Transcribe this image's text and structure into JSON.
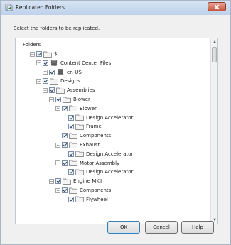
{
  "window": {
    "title": "Replicated Folders",
    "instruction": "Select the folders to be replicated."
  },
  "panel": {
    "label": "Folders"
  },
  "tree": {
    "nodes": [
      {
        "label": "$",
        "depth": 0,
        "expander": "−",
        "checked": true,
        "icon": "folder"
      },
      {
        "label": "Content Center Files",
        "depth": 1,
        "expander": "−",
        "checked": true,
        "icon": "database"
      },
      {
        "label": "en-US",
        "depth": 2,
        "expander": "+",
        "checked": true,
        "icon": "database"
      },
      {
        "label": "Designs",
        "depth": 1,
        "expander": "−",
        "checked": true,
        "icon": "folder"
      },
      {
        "label": "Assemblies",
        "depth": 2,
        "expander": "−",
        "checked": true,
        "icon": "folder"
      },
      {
        "label": "Blower",
        "depth": 3,
        "expander": "−",
        "checked": true,
        "icon": "folder"
      },
      {
        "label": "Blower",
        "depth": 4,
        "expander": "−",
        "checked": true,
        "icon": "folder"
      },
      {
        "label": "Design Accelerator",
        "depth": 5,
        "expander": "",
        "checked": true,
        "icon": "folder"
      },
      {
        "label": "Frame",
        "depth": 5,
        "expander": "",
        "checked": true,
        "icon": "folder"
      },
      {
        "label": "Components",
        "depth": 4,
        "expander": "",
        "checked": true,
        "icon": "folder"
      },
      {
        "label": "Exhaust",
        "depth": 4,
        "expander": "−",
        "checked": true,
        "icon": "folder"
      },
      {
        "label": "Design Accelerator",
        "depth": 5,
        "expander": "",
        "checked": true,
        "icon": "folder"
      },
      {
        "label": "Motor Assembly",
        "depth": 4,
        "expander": "−",
        "checked": true,
        "icon": "folder"
      },
      {
        "label": "Design Accelerator",
        "depth": 5,
        "expander": "",
        "checked": true,
        "icon": "folder"
      },
      {
        "label": "Engine MKII",
        "depth": 3,
        "expander": "−",
        "checked": true,
        "icon": "folder"
      },
      {
        "label": "Components",
        "depth": 4,
        "expander": "−",
        "checked": true,
        "icon": "folder"
      },
      {
        "label": "Flywheel",
        "depth": 5,
        "expander": "",
        "checked": true,
        "icon": "folder"
      }
    ]
  },
  "buttons": {
    "ok": "OK",
    "cancel": "Cancel",
    "help": "Help"
  },
  "icons": {
    "app": "replicate-icon",
    "folder": "folder-icon",
    "database": "database-icon"
  },
  "colors": {
    "folder_fill": "#f4f4f4",
    "folder_stroke": "#6e6e6e",
    "database_fill": "#7a7a7a",
    "close_red": "#c8533b"
  }
}
